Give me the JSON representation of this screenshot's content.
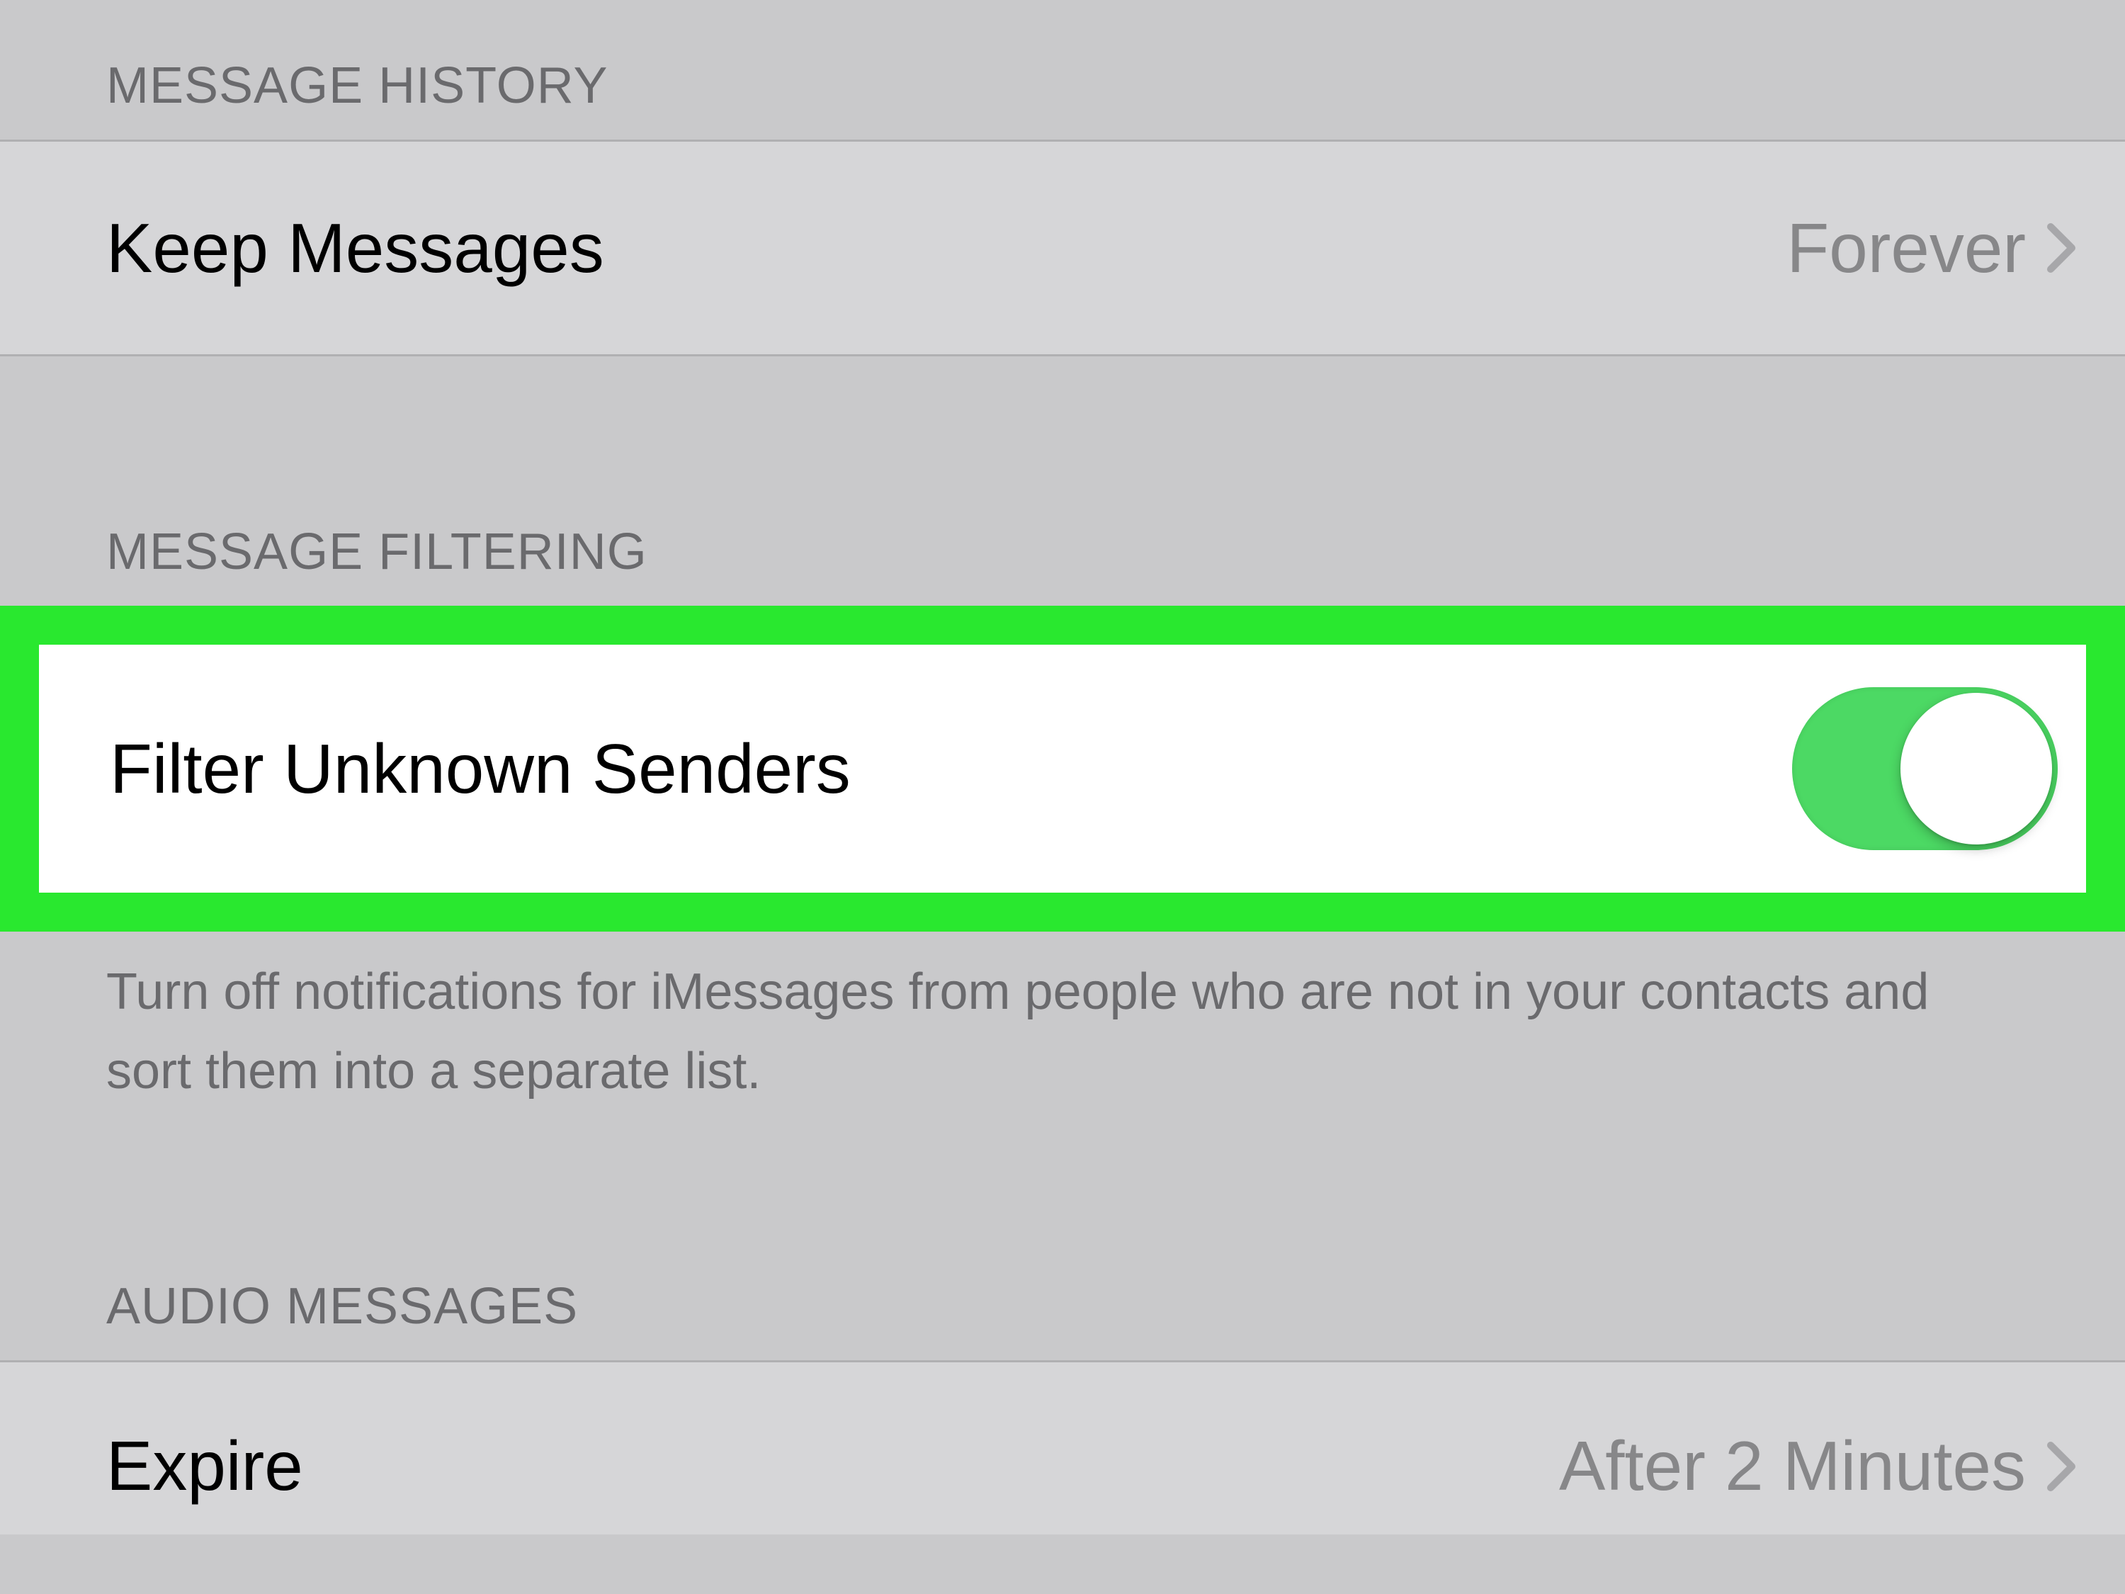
{
  "sections": {
    "message_history": {
      "header": "MESSAGE HISTORY",
      "keep_messages": {
        "label": "Keep Messages",
        "value": "Forever"
      }
    },
    "message_filtering": {
      "header": "MESSAGE FILTERING",
      "filter_unknown": {
        "label": "Filter Unknown Senders",
        "enabled": true
      },
      "footer": "Turn off notifications for iMessages from people who are not in your contacts and sort them into a separate list."
    },
    "audio_messages": {
      "header": "AUDIO MESSAGES",
      "expire": {
        "label": "Expire",
        "value": "After 2 Minutes"
      }
    }
  },
  "colors": {
    "highlight": "#29e82f",
    "toggle_on": "#4cd964",
    "background": "#c9c9cb",
    "cell_background": "#d6d6d8"
  }
}
